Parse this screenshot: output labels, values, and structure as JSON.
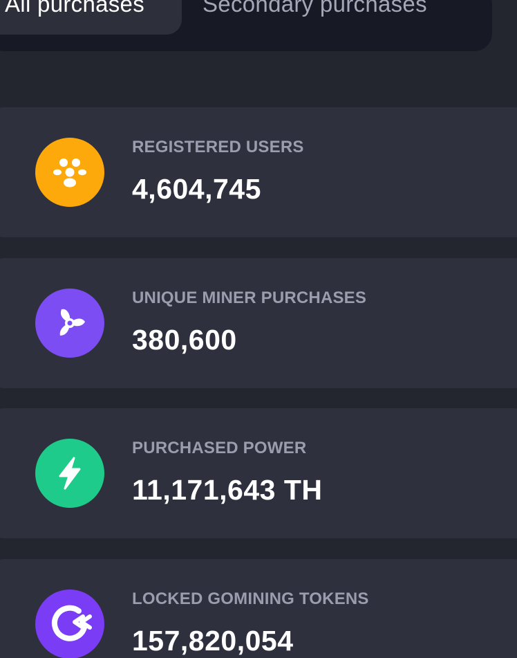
{
  "tabs": [
    {
      "label": "All purchases",
      "active": true
    },
    {
      "label": "Secondary purchases",
      "active": false
    }
  ],
  "stats": [
    {
      "label": "REGISTERED USERS",
      "value": "4,604,745",
      "icon": "users-icon",
      "color": "#fda90b"
    },
    {
      "label": "UNIQUE MINER PURCHASES",
      "value": "380,600",
      "icon": "fan-icon",
      "color": "#7c4df2"
    },
    {
      "label": "PURCHASED POWER",
      "value": "11,171,643 TH",
      "icon": "lightning-icon",
      "color": "#1ecb8a"
    },
    {
      "label": "LOCKED GOMINING TOKENS",
      "value": "157,820,054",
      "icon": "gomining-logo-icon",
      "color": "#7a3cf5"
    }
  ]
}
